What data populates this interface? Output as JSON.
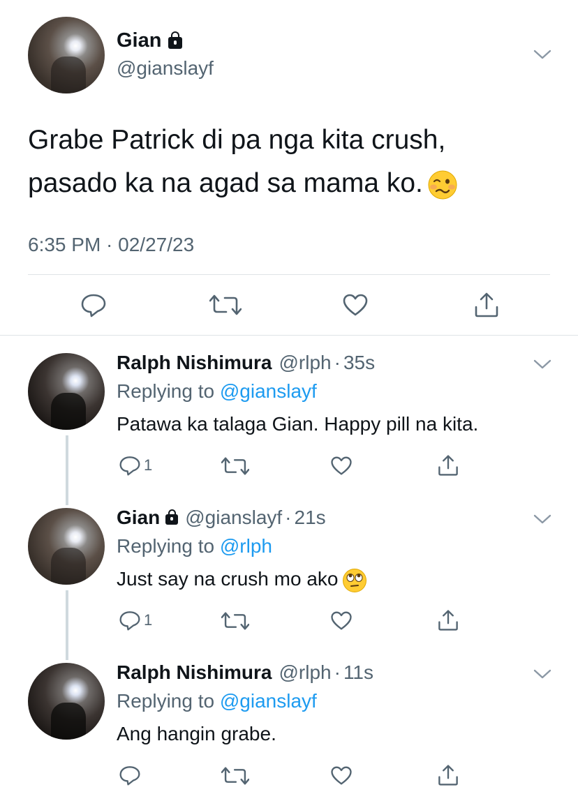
{
  "main_tweet": {
    "display_name": "Gian",
    "handle": "@gianslayf",
    "text_line1": "Grabe Patrick di pa nga kita crush,",
    "text_line2": "pasado ka na agad sa mama ko.",
    "emoji": "woozy-face",
    "timestamp": "6:35 PM · 02/27/23"
  },
  "replies": [
    {
      "display_name": "Ralph Nishimura",
      "handle": "@rlph",
      "time": "35s",
      "replying_prefix": "Replying to",
      "replying_to": "@gianslayf",
      "text": "Patawa ka talaga Gian. Happy pill na kita.",
      "reply_count": "1"
    },
    {
      "display_name": "Gian",
      "handle": "@gianslayf",
      "time": "21s",
      "replying_prefix": "Replying to",
      "replying_to": "@rlph",
      "text": "Just say na crush mo ako",
      "emoji": "rolling-eyes-face",
      "reply_count": "1"
    },
    {
      "display_name": "Ralph Nishimura",
      "handle": "@rlph",
      "time": "11s",
      "replying_prefix": "Replying to",
      "replying_to": "@gianslayf",
      "text": "Ang hangin grabe."
    }
  ],
  "colors": {
    "text_primary": "#0f1419",
    "text_secondary": "#536471",
    "link": "#1d9bf0",
    "divider": "#dfe3e6",
    "thread_line": "#cfd9de"
  },
  "icons": [
    "lock-icon",
    "chevron-down-icon",
    "reply-icon",
    "retweet-icon",
    "like-icon",
    "share-icon"
  ]
}
